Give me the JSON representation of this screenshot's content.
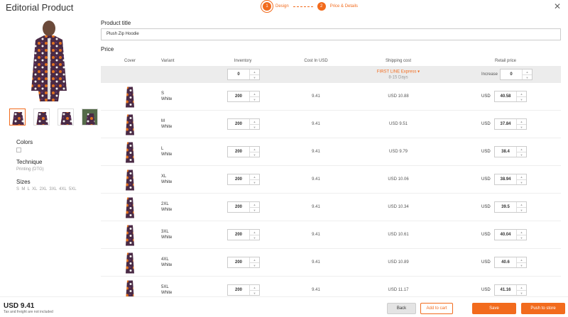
{
  "header": {
    "title": "Editorial Product",
    "steps": [
      {
        "num": "1",
        "label": "Design"
      },
      {
        "num": "2",
        "label": "Price & Details"
      }
    ],
    "close_icon": "close-icon"
  },
  "colors_theme": {
    "accent": "#f26b1d",
    "bulk_row_bg": "#ececec"
  },
  "left": {
    "colors_label": "Colors",
    "technique_label": "Technique",
    "technique_value": "Printing (DTG)",
    "sizes_label": "Sizes",
    "sizes_value": "S  M  L  XL  2XL  3XL  4XL  5XL"
  },
  "product": {
    "title_label": "Product title",
    "title_value": "Plush Zip Hoodie",
    "price_label": "Price"
  },
  "table": {
    "headers": {
      "cover": "Cover",
      "variant": "Variant",
      "inventory": "Inventory",
      "cost": "Cost In USD",
      "shipping": "Shipping cost",
      "retail": "Retail price"
    },
    "bulk": {
      "inventory": "0",
      "shipping_method": "FIRST LINE Express ▾",
      "shipping_days": "8-15 Days",
      "increase_label": "Increase",
      "increase_value": "0"
    },
    "rows": [
      {
        "size": "S",
        "color": "White",
        "inventory": "200",
        "cost": "9.41",
        "shipping": "USD 10.88",
        "currency": "USD",
        "retail": "40.58"
      },
      {
        "size": "M",
        "color": "White",
        "inventory": "200",
        "cost": "9.41",
        "shipping": "USD 9.51",
        "currency": "USD",
        "retail": "37.84"
      },
      {
        "size": "L",
        "color": "White",
        "inventory": "200",
        "cost": "9.41",
        "shipping": "USD 9.79",
        "currency": "USD",
        "retail": "38.4"
      },
      {
        "size": "XL",
        "color": "White",
        "inventory": "200",
        "cost": "9.41",
        "shipping": "USD 10.06",
        "currency": "USD",
        "retail": "38.94"
      },
      {
        "size": "2XL",
        "color": "White",
        "inventory": "200",
        "cost": "9.41",
        "shipping": "USD 10.34",
        "currency": "USD",
        "retail": "39.5"
      },
      {
        "size": "3XL",
        "color": "White",
        "inventory": "200",
        "cost": "9.41",
        "shipping": "USD 10.61",
        "currency": "USD",
        "retail": "40.04"
      },
      {
        "size": "4XL",
        "color": "White",
        "inventory": "200",
        "cost": "9.41",
        "shipping": "USD 10.89",
        "currency": "USD",
        "retail": "40.6"
      },
      {
        "size": "5XL",
        "color": "White",
        "inventory": "200",
        "cost": "9.41",
        "shipping": "USD 11.17",
        "currency": "USD",
        "retail": "41.16"
      }
    ]
  },
  "footer": {
    "total": "USD 9.41",
    "note": "Tax and freight are not included",
    "back_label": "Back",
    "cart_label": "Add to cart",
    "save_label": "Save",
    "push_label": "Push to store"
  }
}
